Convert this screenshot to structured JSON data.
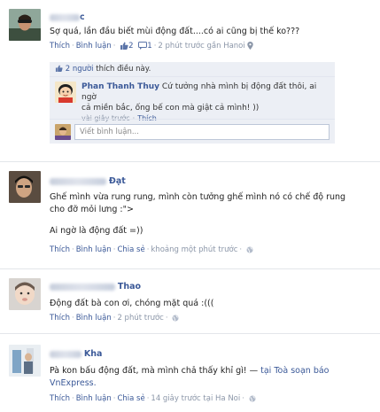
{
  "posts": [
    {
      "name_suffix": "c",
      "text": "Sợ quá, lần đầu biết mùi động đất....có ai cũng bị thế ko???",
      "actions": {
        "like": "Thích",
        "comment": "Bình luận",
        "comment_count": "2",
        "share_count": "1",
        "time": "2 phút trước gần Hanoi"
      },
      "likes_text": {
        "prefix": "2 người",
        "suffix": " thích điều này."
      },
      "comment": {
        "name": "Phan Thanh Thuy",
        "text_line1": "Cứ tưởng nhà mình bị động đất thôi, ai ngờ",
        "text_line2": "cả miền bắc, ống bế con mà giật cả mình! ))",
        "time": "vài giây trước",
        "like": "Thích"
      },
      "write_placeholder": "Viết bình luận..."
    },
    {
      "name": "Đạt",
      "text_line1": "Ghế mình vừa rung rung, mình còn tưởng ghế mình nó có chế độ rung",
      "text_line2": "cho đỡ mỏi lưng :\">",
      "text_line3": "Ai ngờ là động đất =))",
      "actions": {
        "like": "Thích",
        "comment": "Bình luận",
        "share": "Chia sẻ",
        "time": "khoảng một phút trước"
      }
    },
    {
      "name": "Thao",
      "text": "Động đất bà con ơi, chóng mặt quá :(((",
      "actions": {
        "like": "Thích",
        "comment": "Bình luận",
        "time": "2 phút trước"
      }
    },
    {
      "name": "Kha",
      "text_line1_a": "Pà kon bấu động đất, mà mình chả thấy khỉ gì! — ",
      "text_line1_b": "tại ",
      "text_line1_place": "Toà soạn báo",
      "text_line2": "VnExpress.",
      "actions": {
        "like": "Thích",
        "comment": "Bình luận",
        "share": "Chia sẻ",
        "time": "14 giây trước tại Ha Noi"
      }
    }
  ],
  "colors": {
    "link": "#3b5998",
    "meta": "#8b96a8",
    "likes_bg": "#eceff5"
  },
  "icons": [
    "like-thumb-icon",
    "comment-bubble-icon",
    "globe-icon",
    "location-pin-icon"
  ]
}
